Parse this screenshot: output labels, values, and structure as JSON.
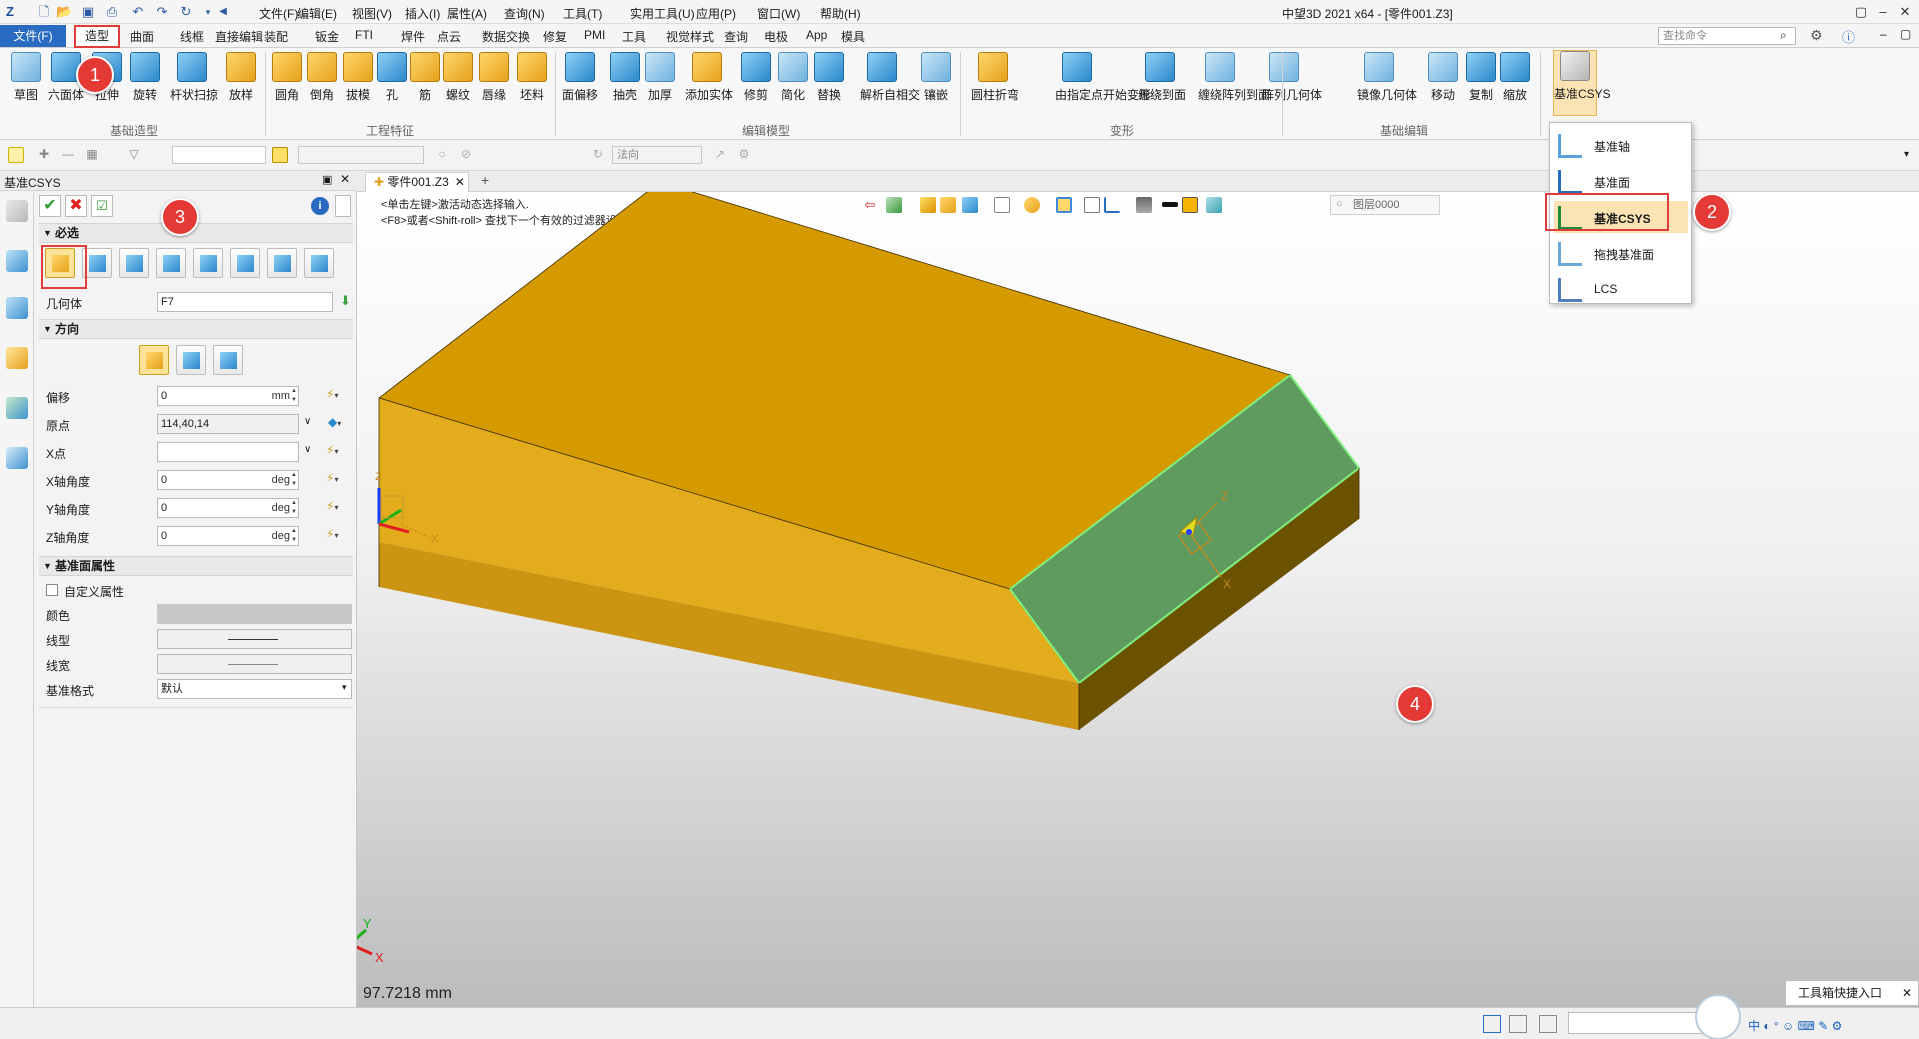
{
  "window": {
    "title": "中望3D 2021 x64 - [零件001.Z3]",
    "menu": [
      "文件(F)",
      "编辑(E)",
      "视图(V)",
      "插入(I)",
      "属性(A)",
      "查询(N)",
      "工具(T)",
      "实用工具(U)",
      "应用(P)",
      "窗口(W)",
      "帮助(H)"
    ],
    "search_placeholder": "查找命令"
  },
  "ribbon_tabs": {
    "file": "文件(F)",
    "active": "造型",
    "others": [
      "曲面",
      "线框",
      "直接编辑",
      "装配",
      "钣金",
      "FTI",
      "焊件",
      "点云",
      "数据交换",
      "修复",
      "PMI",
      "工具",
      "视觉样式",
      "查询",
      "电极",
      "App",
      "模具"
    ]
  },
  "ribbon": {
    "groups": [
      "基础造型",
      "工程特征",
      "编辑模型",
      "变形",
      "基础编辑"
    ],
    "buttons": [
      "草图",
      "六面体",
      "拉伸",
      "旋转",
      "杆状扫掠",
      "放样",
      "圆角",
      "倒角",
      "拔模",
      "孔",
      "筋",
      "螺纹",
      "唇缘",
      "坯料",
      "面偏移",
      "抽壳",
      "加厚",
      "添加实体",
      "修剪",
      "简化",
      "替换",
      "解析自相交",
      "镶嵌",
      "圆柱折弯",
      "由指定点开始变形",
      "缠绕到面",
      "缠绕阵列到面",
      "阵列几何体",
      "镜像几何体",
      "移动",
      "复制",
      "缩放",
      "基准CSYS"
    ]
  },
  "datum_menu": [
    "基准轴",
    "基准面",
    "基准CSYS",
    "拖拽基准面",
    "LCS"
  ],
  "toolbar": {
    "filter_value": "",
    "direction_label": "法向"
  },
  "panel": {
    "title": "基准CSYS",
    "section_required": "必选",
    "geometry_label": "几何体",
    "geometry_value": "F7",
    "section_direction": "方向",
    "fields": [
      {
        "label": "偏移",
        "value": "0",
        "unit": "mm"
      },
      {
        "label": "原点",
        "value": "114,40,14",
        "unit": ""
      },
      {
        "label": "X点",
        "value": "",
        "unit": ""
      },
      {
        "label": "X轴角度",
        "value": "0",
        "unit": "deg"
      },
      {
        "label": "Y轴角度",
        "value": "0",
        "unit": "deg"
      },
      {
        "label": "Z轴角度",
        "value": "0",
        "unit": "deg"
      }
    ],
    "section_props": "基准面属性",
    "custom_label": "自定义属性",
    "color_label": "颜色",
    "linetype_label": "线型",
    "linewidth_label": "线宽",
    "style_label": "基准格式",
    "style_value": "默认"
  },
  "document": {
    "tab": "零件001.Z3",
    "hint1": "<单击左键>激活动态选择输入.",
    "hint2": "<F8>或者<Shift-roll> 查找下一个有效的过滤器设置.",
    "layer": "图层0000",
    "measure": "97.7218 mm"
  },
  "axes": {
    "x": "X",
    "y": "Y",
    "z": "Z"
  },
  "markers": [
    "1",
    "2",
    "3",
    "4"
  ],
  "status": {
    "toolbox": "工具箱快捷入口"
  },
  "colors": {
    "part_face": "#d49a00",
    "selected_face": "#5f9a5f",
    "accent": "#2a6bc2",
    "marker": "#e53935"
  }
}
